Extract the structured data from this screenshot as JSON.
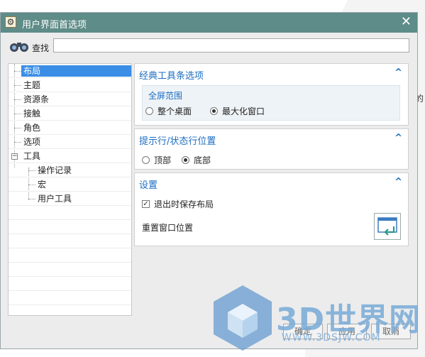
{
  "window": {
    "title": "用户界面首选项",
    "close": "✕"
  },
  "search": {
    "label": "查找",
    "value": "",
    "placeholder": ""
  },
  "tree": {
    "items": [
      {
        "label": "布局",
        "selected": true
      },
      {
        "label": "主题"
      },
      {
        "label": "资源条"
      },
      {
        "label": "接触"
      },
      {
        "label": "角色"
      },
      {
        "label": "选项"
      },
      {
        "label": "工具",
        "expander": "−"
      },
      {
        "label": "操作记录"
      },
      {
        "label": "宏"
      },
      {
        "label": "用户工具"
      }
    ]
  },
  "panels": {
    "toolbar": {
      "title": "经典工具条选项",
      "group_title": "全屏范围",
      "option1": "整个桌面",
      "option2": "最大化窗口",
      "selected": "最大化窗口"
    },
    "status": {
      "title": "提示行/状态行位置",
      "option1": "顶部",
      "option2": "底部",
      "selected": "底部"
    },
    "settings": {
      "title": "设置",
      "save_layout": "退出时保存布局",
      "save_layout_checked": true,
      "reset_label": "重置窗口位置"
    }
  },
  "chevron": "^",
  "buttons": {
    "ok": "确定",
    "apply": "应用",
    "cancel": "取消"
  },
  "background_text": "的",
  "watermark": {
    "text": "3D世界网",
    "url": "WWW.3DSJW.COM"
  },
  "colors": {
    "titlebar": "#5e8c88",
    "accent": "#1c6dc1",
    "selection": "#3a8ee6"
  }
}
